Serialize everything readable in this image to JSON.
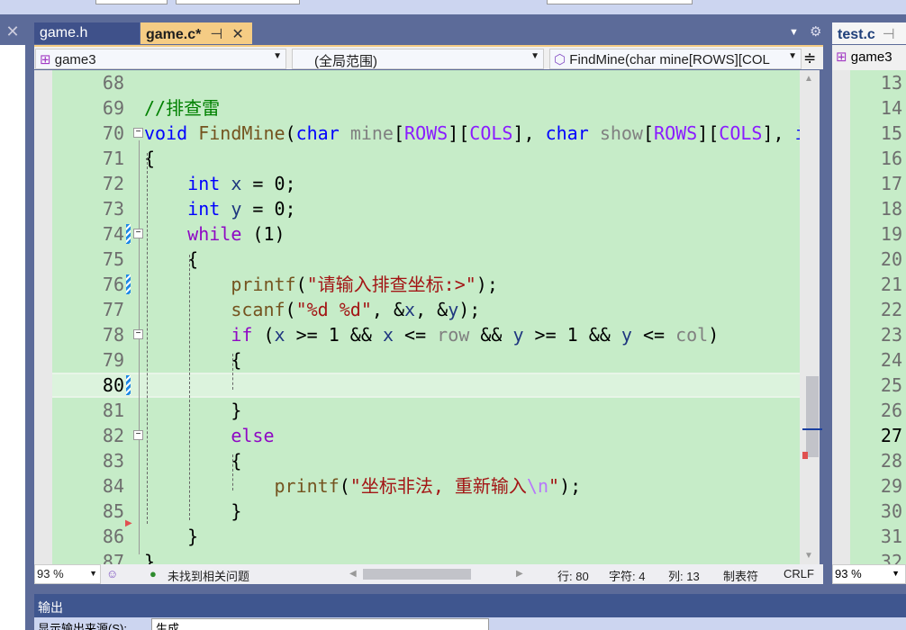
{
  "tabs": [
    {
      "label": "game.h"
    },
    {
      "label": "game.c*",
      "pin": "⊣",
      "close": "✕"
    },
    {
      "label": "test.c",
      "pin": "⊣"
    }
  ],
  "nav": {
    "project": "game3",
    "scope": "(全局范围)",
    "member": "FindMine(char mine[ROWS][COL",
    "right_project": "game3"
  },
  "code_lines": [
    {
      "n": "68",
      "t": []
    },
    {
      "n": "69",
      "t": [
        [
          "//排查雷",
          "cm"
        ]
      ]
    },
    {
      "n": "70",
      "t": [
        [
          "void",
          "kw"
        ],
        [
          " ",
          "pl"
        ],
        [
          "FindMine",
          "fn"
        ],
        [
          "(",
          "pl"
        ],
        [
          "char",
          "kw"
        ],
        [
          " ",
          "pl"
        ],
        [
          "mine",
          "prm"
        ],
        [
          "[",
          "pl"
        ],
        [
          "ROWS",
          "mac"
        ],
        [
          "][",
          "pl"
        ],
        [
          "COLS",
          "mac"
        ],
        [
          "], ",
          "pl"
        ],
        [
          "char",
          "kw"
        ],
        [
          " ",
          "pl"
        ],
        [
          "show",
          "prm"
        ],
        [
          "[",
          "pl"
        ],
        [
          "ROWS",
          "mac"
        ],
        [
          "][",
          "pl"
        ],
        [
          "COLS",
          "mac"
        ],
        [
          "], ",
          "pl"
        ],
        [
          "int",
          "kw"
        ]
      ]
    },
    {
      "n": "71",
      "t": [
        [
          "{",
          "pl"
        ]
      ]
    },
    {
      "n": "72",
      "t": [
        [
          "    ",
          "pl"
        ],
        [
          "int",
          "kw"
        ],
        [
          " ",
          "pl"
        ],
        [
          "x",
          "var"
        ],
        [
          " = 0;",
          "pl"
        ]
      ]
    },
    {
      "n": "73",
      "t": [
        [
          "    ",
          "pl"
        ],
        [
          "int",
          "kw"
        ],
        [
          " ",
          "pl"
        ],
        [
          "y",
          "var"
        ],
        [
          " = 0;",
          "pl"
        ]
      ]
    },
    {
      "n": "74",
      "t": [
        [
          "    ",
          "pl"
        ],
        [
          "while",
          "ctl"
        ],
        [
          " (1)",
          "pl"
        ]
      ]
    },
    {
      "n": "75",
      "t": [
        [
          "    {",
          "pl"
        ]
      ]
    },
    {
      "n": "76",
      "t": [
        [
          "        ",
          "pl"
        ],
        [
          "printf",
          "fn"
        ],
        [
          "(",
          "pl"
        ],
        [
          "\"请输入排查坐标:>\"",
          "str"
        ],
        [
          ");",
          "pl"
        ]
      ]
    },
    {
      "n": "77",
      "t": [
        [
          "        ",
          "pl"
        ],
        [
          "scanf",
          "fn"
        ],
        [
          "(",
          "pl"
        ],
        [
          "\"%d %d\"",
          "str"
        ],
        [
          ", &",
          "pl"
        ],
        [
          "x",
          "var"
        ],
        [
          ", &",
          "pl"
        ],
        [
          "y",
          "var"
        ],
        [
          ");",
          "pl"
        ]
      ]
    },
    {
      "n": "78",
      "t": [
        [
          "        ",
          "pl"
        ],
        [
          "if",
          "ctl"
        ],
        [
          " (",
          "pl"
        ],
        [
          "x",
          "var"
        ],
        [
          " >= 1 && ",
          "pl"
        ],
        [
          "x",
          "var"
        ],
        [
          " <= ",
          "pl"
        ],
        [
          "row",
          "prm"
        ],
        [
          " && ",
          "pl"
        ],
        [
          "y",
          "var"
        ],
        [
          " >= 1 && ",
          "pl"
        ],
        [
          "y",
          "var"
        ],
        [
          " <= ",
          "pl"
        ],
        [
          "col",
          "prm"
        ],
        [
          ")",
          "pl"
        ]
      ]
    },
    {
      "n": "79",
      "t": [
        [
          "        {",
          "pl"
        ]
      ]
    },
    {
      "n": "80",
      "t": []
    },
    {
      "n": "81",
      "t": [
        [
          "        }",
          "pl"
        ]
      ]
    },
    {
      "n": "82",
      "t": [
        [
          "        ",
          "pl"
        ],
        [
          "else",
          "ctl"
        ]
      ]
    },
    {
      "n": "83",
      "t": [
        [
          "        {",
          "pl"
        ]
      ]
    },
    {
      "n": "84",
      "t": [
        [
          "            ",
          "pl"
        ],
        [
          "printf",
          "fn"
        ],
        [
          "(",
          "pl"
        ],
        [
          "\"坐标非法, 重新输入",
          "str"
        ],
        [
          "\\n",
          "esc"
        ],
        [
          "\"",
          "str"
        ],
        [
          ");",
          "pl"
        ]
      ]
    },
    {
      "n": "85",
      "t": [
        [
          "        }",
          "pl"
        ]
      ]
    },
    {
      "n": "86",
      "t": [
        [
          "    }",
          "pl"
        ]
      ]
    },
    {
      "n": "87",
      "t": [
        [
          "}",
          "pl"
        ]
      ]
    }
  ],
  "current_line": "80",
  "right_lines": [
    "13",
    "14",
    "15",
    "16",
    "17",
    "18",
    "19",
    "20",
    "21",
    "22",
    "23",
    "24",
    "25",
    "26",
    "27",
    "28",
    "29",
    "30",
    "31",
    "32"
  ],
  "right_current": "27",
  "status": {
    "zoom": "93 %",
    "issues": "未找到相关问题",
    "row": "行: 80",
    "char": "字符: 4",
    "col": "列: 13",
    "tabs": "制表符",
    "eol": "CRLF",
    "right_zoom": "93 %"
  },
  "output": {
    "title": "输出",
    "source_label": "显示输出来源(S):",
    "source_value": "生成"
  },
  "colors": {
    "editor_bg": "#c6ecc8",
    "active_tab": "#f5cc84",
    "frame": "#5c6b99",
    "keyword": "#0000ff",
    "control": "#8f08c4",
    "string": "#a31515"
  }
}
